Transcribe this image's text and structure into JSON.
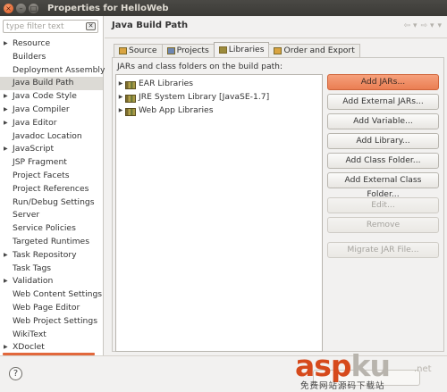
{
  "window": {
    "title": "Properties for HelloWeb",
    "controls": [
      "close",
      "minimize",
      "maximize"
    ]
  },
  "sidebar": {
    "filter_placeholder": "type filter text",
    "items": [
      {
        "label": "Resource",
        "expandable": true,
        "selected": false
      },
      {
        "label": "Builders",
        "expandable": false,
        "selected": false
      },
      {
        "label": "Deployment Assembly",
        "expandable": false,
        "selected": false
      },
      {
        "label": "Java Build Path",
        "expandable": false,
        "selected": true
      },
      {
        "label": "Java Code Style",
        "expandable": true,
        "selected": false
      },
      {
        "label": "Java Compiler",
        "expandable": true,
        "selected": false
      },
      {
        "label": "Java Editor",
        "expandable": true,
        "selected": false
      },
      {
        "label": "Javadoc Location",
        "expandable": false,
        "selected": false
      },
      {
        "label": "JavaScript",
        "expandable": true,
        "selected": false
      },
      {
        "label": "JSP Fragment",
        "expandable": false,
        "selected": false
      },
      {
        "label": "Project Facets",
        "expandable": false,
        "selected": false
      },
      {
        "label": "Project References",
        "expandable": false,
        "selected": false
      },
      {
        "label": "Run/Debug Settings",
        "expandable": false,
        "selected": false
      },
      {
        "label": "Server",
        "expandable": false,
        "selected": false
      },
      {
        "label": "Service Policies",
        "expandable": false,
        "selected": false
      },
      {
        "label": "Targeted Runtimes",
        "expandable": false,
        "selected": false
      },
      {
        "label": "Task Repository",
        "expandable": true,
        "selected": false
      },
      {
        "label": "Task Tags",
        "expandable": false,
        "selected": false
      },
      {
        "label": "Validation",
        "expandable": true,
        "selected": false
      },
      {
        "label": "Web Content Settings",
        "expandable": false,
        "selected": false
      },
      {
        "label": "Web Page Editor",
        "expandable": false,
        "selected": false
      },
      {
        "label": "Web Project Settings",
        "expandable": false,
        "selected": false
      },
      {
        "label": "WikiText",
        "expandable": false,
        "selected": false
      },
      {
        "label": "XDoclet",
        "expandable": true,
        "selected": false
      }
    ]
  },
  "main": {
    "heading": "Java Build Path",
    "tabs": [
      {
        "label": "Source",
        "active": false
      },
      {
        "label": "Projects",
        "active": false
      },
      {
        "label": "Libraries",
        "active": true
      },
      {
        "label": "Order and Export",
        "active": false
      }
    ],
    "list_label": "JARs and class folders on the build path:",
    "libraries": [
      {
        "label": "EAR Libraries"
      },
      {
        "label": "JRE System Library [JavaSE-1.7]"
      },
      {
        "label": "Web App Libraries"
      }
    ],
    "buttons": [
      {
        "label": "Add JARs...",
        "state": "default"
      },
      {
        "label": "Add External JARs...",
        "state": "enabled"
      },
      {
        "label": "Add Variable...",
        "state": "enabled"
      },
      {
        "label": "Add Library...",
        "state": "enabled"
      },
      {
        "label": "Add Class Folder...",
        "state": "enabled"
      },
      {
        "label": "Add External Class Folder...",
        "state": "enabled"
      },
      {
        "label": "Edit...",
        "state": "disabled"
      },
      {
        "label": "Remove",
        "state": "disabled"
      },
      {
        "label": "Migrate JAR File...",
        "state": "disabled"
      }
    ]
  },
  "footer": {
    "help_symbol": "?"
  },
  "watermark": {
    "brand_a": "asp",
    "brand_b": "ku",
    "domain_suffix": ".net",
    "tagline": "免费网站源码下载站"
  },
  "colors": {
    "accent": "#ea7e53",
    "selection": "#dcdad5",
    "titlebar": "#3b3a36"
  }
}
